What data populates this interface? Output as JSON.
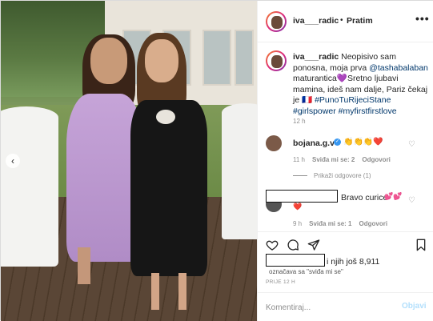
{
  "header": {
    "username": "iva___radic",
    "separator": "•",
    "follow_label": "Pratim",
    "more_icon": "more-horizontal-icon"
  },
  "caption": {
    "username": "iva___radic",
    "text_line1": " Neopisivo sam ponosna, moja prva ",
    "mention": "@tashabalaban",
    "text_line2": " maturantica",
    "heart_emoji": "💜",
    "text_line3": "Sretno ljubavi mamina, ideš nam dalje, Pariz čekaj je ",
    "flag_emoji": "🇫🇷",
    "hashtags": "#PunoTuRijeciStane #girlspower #myfirstfirstlove",
    "hashtag1": "#PunoTuRijeciStane",
    "hashtag2": "#girlspower",
    "hashtag3": "#myfirstfirstlove",
    "time": "12 h"
  },
  "comment1": {
    "username": "bojana.g.v",
    "emoji": "👏👏👏❤️",
    "time": "11 h",
    "likes": "Sviđa mi se: 2",
    "reply": "Odgovori",
    "show_replies": "Prikaži odgovore (1)"
  },
  "comment2": {
    "text": "Bravo curice",
    "emoji": "💕💕",
    "emoji2": "❤️",
    "time": "9 h",
    "likes": "Sviđa mi se: 1",
    "reply": "Odgovori"
  },
  "likes": {
    "text": "i njih još 8,911",
    "sub": "označava sa \"sviđa mi se\""
  },
  "posted": "PRIJE 12 H",
  "add_comment": {
    "placeholder": "Komentiraj...",
    "post_label": "Objavi"
  },
  "colors": {
    "link": "#00376b",
    "verified": "#3897f0",
    "muted": "#8e8e8e",
    "post_disabled": "#b2dffc"
  }
}
